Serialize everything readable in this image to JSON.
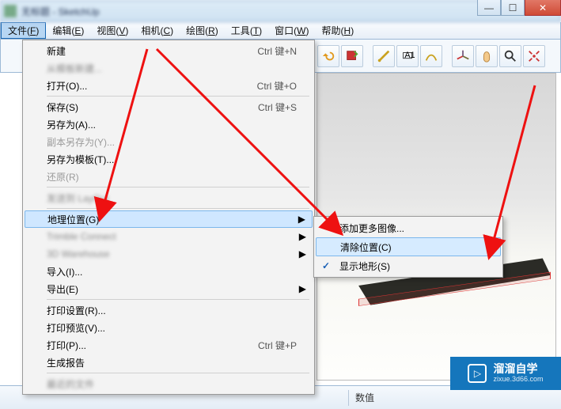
{
  "window": {
    "title": "无标题 - SketchUp"
  },
  "menubar": {
    "items": [
      {
        "label": "文件",
        "accel": "F"
      },
      {
        "label": "编辑",
        "accel": "E"
      },
      {
        "label": "视图",
        "accel": "V"
      },
      {
        "label": "相机",
        "accel": "C"
      },
      {
        "label": "绘图",
        "accel": "R"
      },
      {
        "label": "工具",
        "accel": "T"
      },
      {
        "label": "窗口",
        "accel": "W"
      },
      {
        "label": "帮助",
        "accel": "H"
      }
    ]
  },
  "fileMenu": {
    "new": {
      "label": "新建",
      "shortcut": "Ctrl 键+N"
    },
    "newFromTemplate": {
      "label": "从模板新建..."
    },
    "open": {
      "label": "打开(O)...",
      "shortcut": "Ctrl 键+O"
    },
    "save": {
      "label": "保存(S)",
      "shortcut": "Ctrl 键+S"
    },
    "saveAs": {
      "label": "另存为(A)..."
    },
    "saveCopyAs": {
      "label": "副本另存为(Y)..."
    },
    "saveAsTemplate": {
      "label": "另存为模板(T)..."
    },
    "revert": {
      "label": "还原(R)"
    },
    "blurred1": {
      "label": "发送到 LayOut"
    },
    "geoLocation": {
      "label": "地理位置(G)"
    },
    "blurred2": {
      "label": "Trimble Connect"
    },
    "blurred3": {
      "label": "3D Warehouse"
    },
    "import": {
      "label": "导入(I)..."
    },
    "export": {
      "label": "导出(E)"
    },
    "printSetup": {
      "label": "打印设置(R)..."
    },
    "printPreview": {
      "label": "打印预览(V)..."
    },
    "print": {
      "label": "打印(P)...",
      "shortcut": "Ctrl 键+P"
    },
    "generateReport": {
      "label": "生成报告"
    },
    "blurred4": {
      "label": "最近的文件"
    }
  },
  "geoSubmenu": {
    "addMore": {
      "label": "添加更多图像..."
    },
    "clear": {
      "label": "清除位置(C)"
    },
    "showTerrain": {
      "label": "显示地形(S)"
    },
    "check": "✓"
  },
  "status": {
    "label": "数值"
  },
  "watermark": {
    "big": "溜溜自学",
    "small": "zixue.3d66.com",
    "play": "▷"
  },
  "toolbar": {
    "icons": [
      "undo",
      "redo",
      "select",
      "tape",
      "dim",
      "text",
      "section",
      "walk",
      "zoom",
      "extents"
    ]
  }
}
